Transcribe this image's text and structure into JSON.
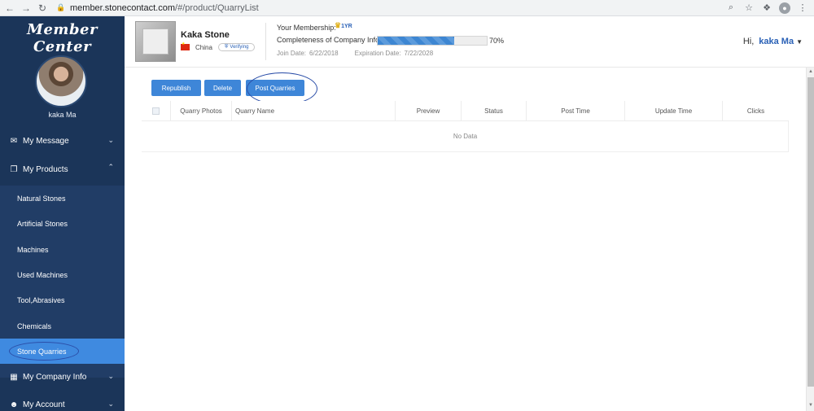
{
  "browser": {
    "url_host": "member.stonecontact.com",
    "url_path": "/#/product/QuarryList"
  },
  "sidebar": {
    "brand": "Member Center",
    "user_name": "kaka Ma",
    "menu": {
      "my_message": "My Message",
      "my_products": "My Products",
      "my_company_info": "My Company Info",
      "my_account": "My Account"
    },
    "products_submenu": [
      {
        "label": "Natural Stones"
      },
      {
        "label": "Artificial Stones"
      },
      {
        "label": "Machines"
      },
      {
        "label": "Used Machines"
      },
      {
        "label": "Tool,Abrasives"
      },
      {
        "label": "Chemicals"
      },
      {
        "label": "Stone Quarries",
        "active": true
      }
    ]
  },
  "header": {
    "company_name": "Kaka Stone",
    "country": "China",
    "verify_status": "Verifying",
    "membership_label": "Your Membership:",
    "membership_badge": "1YR",
    "completeness_label": "Completeness of Company Info:",
    "completeness_percent": 70,
    "completeness_text": "70%",
    "join_label": "Join Date:",
    "join_date": "6/22/2018",
    "expiration_label": "Expiration Date:",
    "expiration_date": "7/22/2028",
    "greeting": "Hi,",
    "greeting_name": "kaka Ma"
  },
  "toolbar": {
    "republish": "Republish",
    "delete": "Delete",
    "post_quarries": "Post Quarries"
  },
  "table": {
    "columns": [
      "Quarry Photos",
      "Quarry Name",
      "Preview",
      "Status",
      "Post Time",
      "Update Time",
      "Clicks"
    ],
    "empty_text": "No Data"
  },
  "colors": {
    "sidebar_bg": "#1b3559",
    "submenu_bg": "#213d66",
    "active_item": "#3f8ae0",
    "primary_button": "#3e86d8",
    "link_blue": "#2a61b6"
  },
  "icons": {
    "message": "mail-icon",
    "products": "copy-icon",
    "company": "building-icon",
    "account": "user-icon"
  }
}
